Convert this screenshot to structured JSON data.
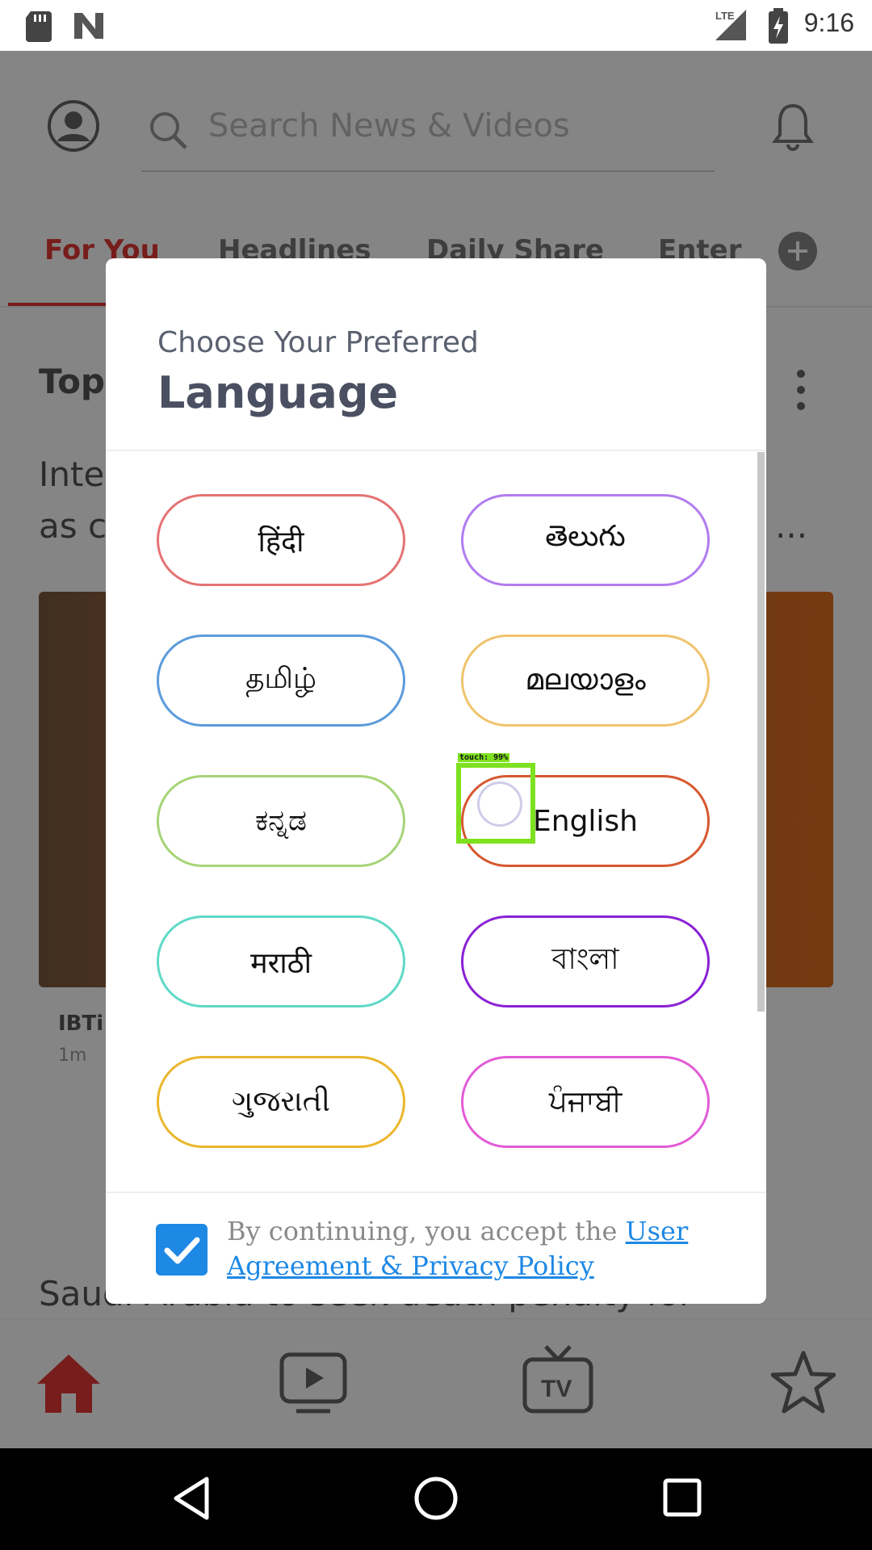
{
  "status_bar": {
    "time": "9:16",
    "network": "LTE"
  },
  "header": {
    "search_placeholder": "Search News & Videos"
  },
  "tabs": [
    {
      "label": "For You",
      "active": true
    },
    {
      "label": "Headlines"
    },
    {
      "label": "Daily Share"
    },
    {
      "label": "Enter"
    }
  ],
  "background": {
    "section_title": "Top",
    "headline_line1": "Inte",
    "headline_line2": "as c",
    "headline_suffix": "...",
    "source": "IBTi",
    "age": "1m",
    "bottom_headline": "Saudi Arabia to seek death penalty for"
  },
  "dialog": {
    "subtitle": "Choose Your Preferred",
    "title": "Language",
    "languages": [
      {
        "label": "हिंदी",
        "color": "#e57373"
      },
      {
        "label": "తెలుగు",
        "color": "#b27cf0"
      },
      {
        "label": "தமிழ்",
        "color": "#5c9bdc"
      },
      {
        "label": "മലയാളം",
        "color": "#f0c36d"
      },
      {
        "label": "ಕನ್ನಡ",
        "color": "#a6d477"
      },
      {
        "label": "English",
        "color": "#d6582f"
      },
      {
        "label": "मराठी",
        "color": "#5fd9c7"
      },
      {
        "label": "বাংলা",
        "color": "#8a21d6"
      },
      {
        "label": "ગુજરાતી",
        "color": "#eab62b"
      },
      {
        "label": "ਪੰਜਾਬੀ",
        "color": "#e25bd6"
      }
    ],
    "terms_prefix": "By continuing, you accept the ",
    "terms_link": "User Agreement & Privacy Policy",
    "checkbox_checked": true
  },
  "touch_overlay": {
    "label": "touch: 99%"
  },
  "colors": {
    "accent": "#e53935",
    "checkbox": "#1e88e5",
    "touch": "#7ee11f"
  }
}
